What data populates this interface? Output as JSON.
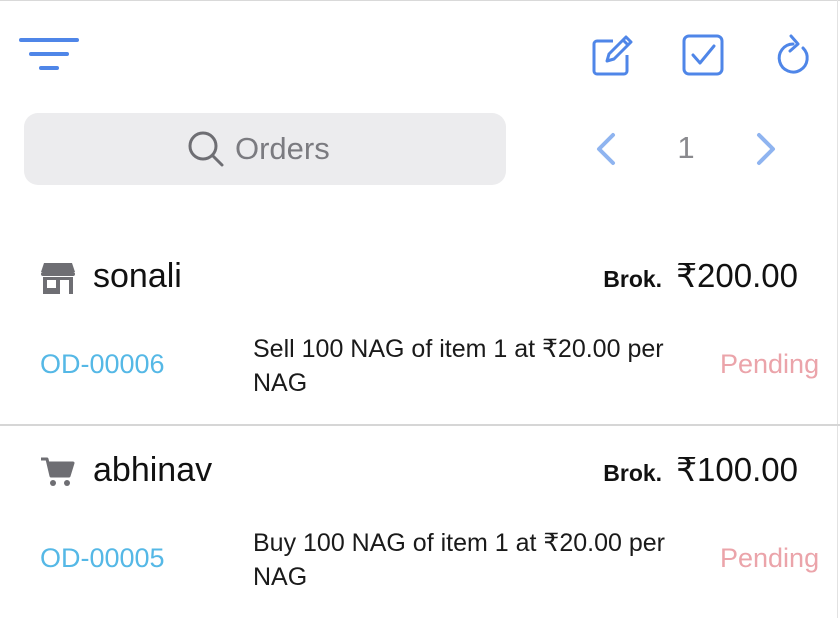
{
  "toolbar": {
    "icons": [
      "filter-icon",
      "edit-icon",
      "checkbox-icon",
      "refresh-icon"
    ],
    "accent_color": "#4f86e8"
  },
  "search": {
    "placeholder": "Orders"
  },
  "pagination": {
    "current_page": "1"
  },
  "orders": [
    {
      "party_icon": "store-icon",
      "party_name": "sonali",
      "brokerage_label": "Brok.",
      "brokerage_value": "₹200.00",
      "order_id": "OD-00006",
      "description": "Sell 100 NAG of item 1 at ₹20.00 per NAG",
      "status": "Pending"
    },
    {
      "party_icon": "cart-icon",
      "party_name": "abhinav",
      "brokerage_label": "Brok.",
      "brokerage_value": "₹100.00",
      "order_id": "OD-00005",
      "description": "Buy 100 NAG of item 1 at ₹20.00 per NAG",
      "status": "Pending"
    }
  ],
  "colors": {
    "order_id": "#55b8e6",
    "status_pending": "#eba4aa",
    "search_bg": "#ececee"
  }
}
